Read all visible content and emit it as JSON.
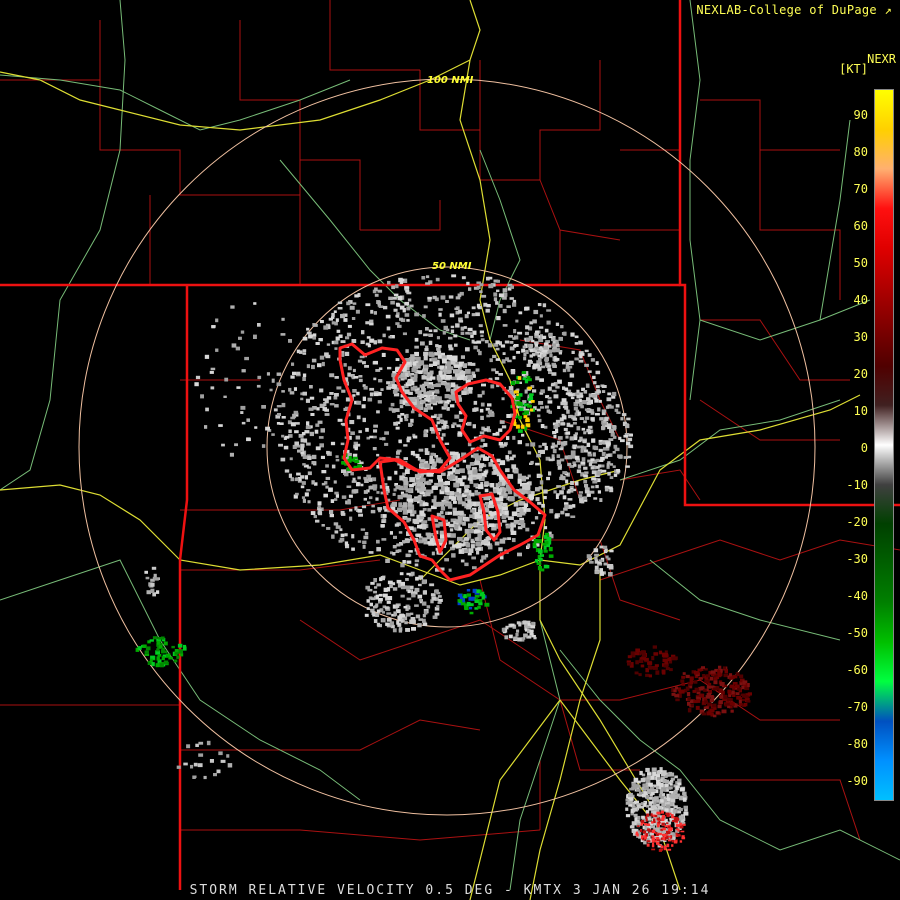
{
  "credit": "NEXLAB-College of DuPage",
  "product_code": "NEXR",
  "units": "[KT]",
  "ring_labels": {
    "inner": "50 NMI",
    "outer": "100 NMI"
  },
  "legend": {
    "ticks": [
      "90",
      "80",
      "70",
      "60",
      "50",
      "40",
      "30",
      "20",
      "10",
      "0",
      "-10",
      "-20",
      "-30",
      "-40",
      "-50",
      "-60",
      "-70",
      "-80",
      "-90"
    ],
    "gradient": [
      "#ffff00",
      "#ffd000",
      "#ffb070",
      "#ff1010",
      "#e00000",
      "#b00000",
      "#800000",
      "#500000",
      "#402020",
      "#ffffff",
      "#404040",
      "#004000",
      "#006000",
      "#008000",
      "#00c000",
      "#00ff40",
      "#0050c0",
      "#0090ff",
      "#00c0ff"
    ]
  },
  "title": "STORM RELATIVE VELOCITY 0.5 DEG - KMTX 3 JAN 26 19:14",
  "colors": {
    "state_border": "#ee1111",
    "county_border": "#aa1111",
    "highway": "#dddd33",
    "road": "#77bb77",
    "range_ring": "#f0c0a0",
    "warning_polygon": "#ff2222"
  }
}
